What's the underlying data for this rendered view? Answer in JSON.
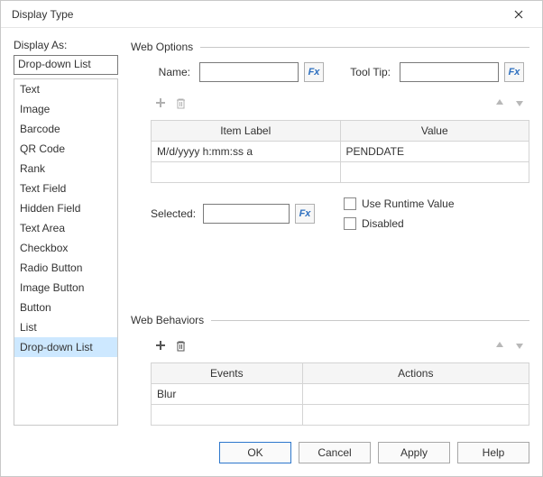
{
  "window": {
    "title": "Display Type"
  },
  "left": {
    "label": "Display As:",
    "selected": "Drop-down List",
    "items": [
      "Text",
      "Image",
      "Barcode",
      "QR Code",
      "Rank",
      "Text Field",
      "Hidden Field",
      "Text Area",
      "Checkbox",
      "Radio Button",
      "Image Button",
      "Button",
      "List",
      "Drop-down List"
    ]
  },
  "options": {
    "header": "Web Options",
    "name_label": "Name:",
    "name_value": "",
    "tooltip_label": "Tool Tip:",
    "tooltip_value": "",
    "table": {
      "col1": "Item Label",
      "col2": "Value",
      "rows": [
        {
          "label": "M/d/yyyy h:mm:ss a",
          "value": "PENDDATE"
        }
      ]
    },
    "selected_label": "Selected:",
    "selected_value": "",
    "use_runtime_label": "Use Runtime Value",
    "use_runtime_checked": false,
    "disabled_label": "Disabled",
    "disabled_checked": false
  },
  "behaviors": {
    "header": "Web Behaviors",
    "col1": "Events",
    "col2": "Actions",
    "rows": [
      {
        "event": "Blur",
        "action": ""
      }
    ]
  },
  "buttons": {
    "ok": "OK",
    "cancel": "Cancel",
    "apply": "Apply",
    "help": "Help"
  },
  "fx": "Fx"
}
